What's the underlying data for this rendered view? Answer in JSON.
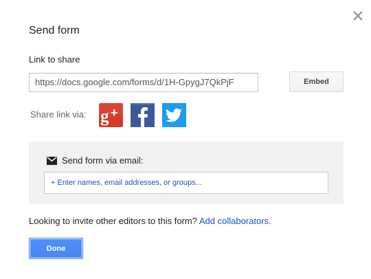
{
  "dialog": {
    "title": "Send form",
    "close_icon": "close-icon"
  },
  "link": {
    "label": "Link to share",
    "url": "https://docs.google.com/forms/d/1H-GpygJ7QkPjF",
    "embed_label": "Embed"
  },
  "share": {
    "label": "Share link via:",
    "networks": [
      {
        "name": "Google+",
        "icon": "google-plus-icon",
        "color": "#d23a2a",
        "glyph": "g+"
      },
      {
        "name": "Facebook",
        "icon": "facebook-icon",
        "color": "#3b5998",
        "glyph": "f"
      },
      {
        "name": "Twitter",
        "icon": "twitter-icon",
        "color": "#1d9bf0"
      }
    ]
  },
  "email": {
    "label": "Send form via email:",
    "icon": "mail-icon",
    "placeholder": "+ Enter names, email addresses, or groups..."
  },
  "invite": {
    "text": "Looking to invite other editors to this form?",
    "link": "Add collaborators."
  },
  "actions": {
    "done_label": "Done",
    "accent": "#4d90fe"
  }
}
